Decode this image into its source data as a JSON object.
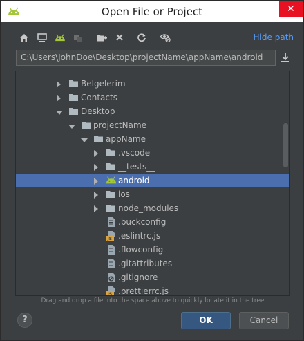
{
  "window": {
    "title": "Open File or Project",
    "close_glyph": "✕"
  },
  "toolbar": {
    "icons": [
      "home-icon",
      "desktop-icon",
      "android-project-icon",
      "module-icon",
      "new-folder-icon",
      "delete-icon",
      "refresh-icon",
      "show-hidden-icon"
    ],
    "hide_path_label": "Hide path"
  },
  "path": {
    "value": "C:\\Users\\JohnDoe\\Desktop\\projectName\\appName\\android"
  },
  "tree": {
    "rows": [
      {
        "label": "Belgelerim",
        "expanded": false,
        "icon": "folder-icon",
        "selected": false
      },
      {
        "label": "Contacts",
        "expanded": false,
        "icon": "folder-icon",
        "selected": false
      },
      {
        "label": "Desktop",
        "expanded": true,
        "icon": "folder-icon",
        "selected": false
      },
      {
        "label": "projectName",
        "expanded": true,
        "icon": "folder-icon",
        "selected": false
      },
      {
        "label": "appName",
        "expanded": true,
        "icon": "folder-icon",
        "selected": false
      },
      {
        "label": ".vscode",
        "expanded": false,
        "icon": "folder-icon",
        "selected": false
      },
      {
        "label": "__tests__",
        "expanded": false,
        "icon": "folder-icon",
        "selected": false
      },
      {
        "label": "android",
        "expanded": false,
        "icon": "android-icon",
        "selected": true
      },
      {
        "label": "ios",
        "expanded": false,
        "icon": "folder-icon",
        "selected": false
      },
      {
        "label": "node_modules",
        "expanded": false,
        "icon": "folder-icon",
        "selected": false
      },
      {
        "label": ".buckconfig",
        "expanded": null,
        "icon": "file-icon",
        "selected": false
      },
      {
        "label": ".eslintrc.js",
        "expanded": null,
        "icon": "js-file-icon",
        "selected": false
      },
      {
        "label": ".flowconfig",
        "expanded": null,
        "icon": "file-icon",
        "selected": false
      },
      {
        "label": ".gitattributes",
        "expanded": null,
        "icon": "file-icon",
        "selected": false
      },
      {
        "label": ".gitignore",
        "expanded": null,
        "icon": "gitignore-file-icon",
        "selected": false
      },
      {
        "label": ".prettierrc.js",
        "expanded": null,
        "icon": "js-file-icon",
        "selected": false
      }
    ]
  },
  "hint": "Drag and drop a file into the space above to quickly locate it in the tree",
  "buttons": {
    "help": "?",
    "ok": "OK",
    "cancel": "Cancel"
  },
  "colors": {
    "background": "#3c3f41",
    "selection": "#4b6eaf",
    "link": "#589df6",
    "android_green": "#a4c639",
    "folder": "#aeb9c0",
    "close_red": "#e81123"
  }
}
